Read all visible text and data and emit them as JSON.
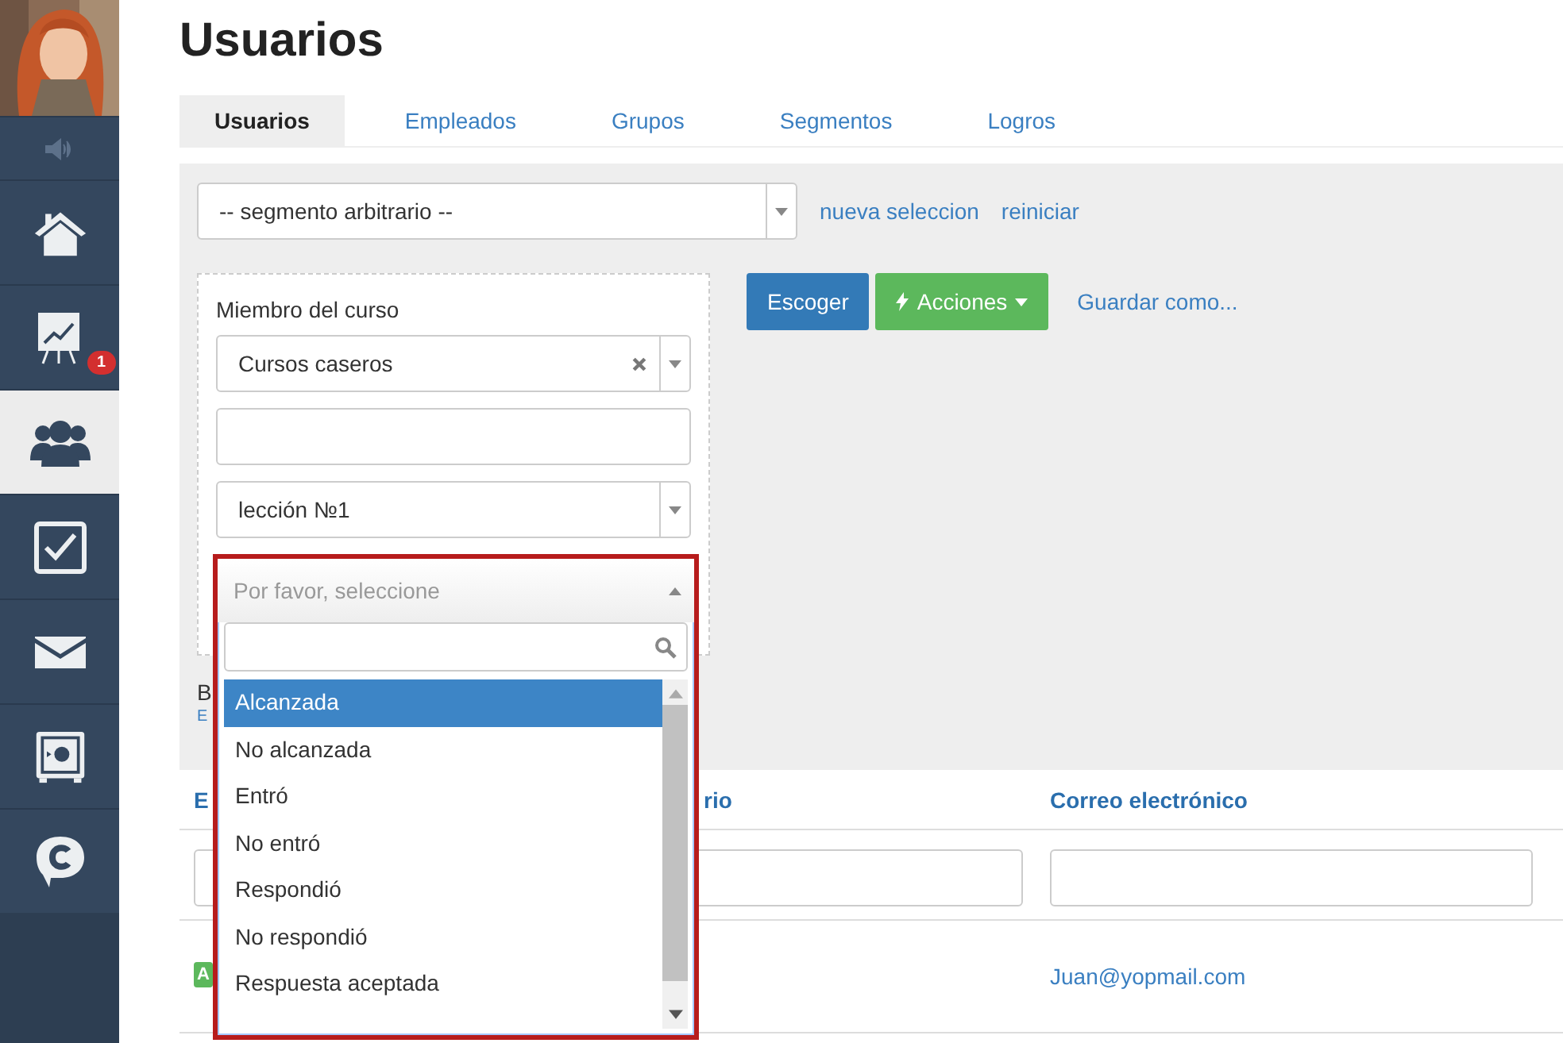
{
  "sidebar": {
    "items": [
      {
        "kind": "speaker",
        "selected": false
      },
      {
        "kind": "home",
        "selected": false
      },
      {
        "kind": "chart",
        "selected": false,
        "badge": "1"
      },
      {
        "kind": "users",
        "selected": true
      },
      {
        "kind": "check",
        "selected": false
      },
      {
        "kind": "mail",
        "selected": false
      },
      {
        "kind": "safe",
        "selected": false
      },
      {
        "kind": "chat",
        "selected": false
      }
    ]
  },
  "title": "Usuarios",
  "tabs": [
    {
      "label": "Usuarios",
      "selected": true
    },
    {
      "label": "Empleados",
      "selected": false
    },
    {
      "label": "Grupos",
      "selected": false
    },
    {
      "label": "Segmentos",
      "selected": false
    },
    {
      "label": "Logros",
      "selected": false
    }
  ],
  "segment_select": {
    "value": "-- segmento arbitrario --"
  },
  "links": [
    "nueva seleccion",
    "reiniciar"
  ],
  "filter": {
    "label": "Miembro del curso",
    "course_select": {
      "value": "Cursos caseros"
    },
    "lesson_select": {
      "value": "lección №1"
    }
  },
  "buttons": [
    {
      "label": "Escoger",
      "kind": "primary"
    },
    {
      "label": "Acciones",
      "kind": "actions"
    }
  ],
  "save_link": "Guardar como...",
  "panel_fragments": [
    "B",
    "E"
  ],
  "table": {
    "columns": [
      "E",
      "rio",
      "Correo electrónico"
    ],
    "rows": [
      {
        "badge": "A",
        "email": "Juan@yopmail.com"
      }
    ]
  },
  "dropdown": {
    "placeholder": "Por favor, seleccione",
    "options": [
      {
        "label": "Alcanzada",
        "selected": true
      },
      {
        "label": "No alcanzada",
        "selected": false
      },
      {
        "label": "Entró",
        "selected": false
      },
      {
        "label": "No entró",
        "selected": false
      },
      {
        "label": "Respondió",
        "selected": false
      },
      {
        "label": "No respondió",
        "selected": false
      },
      {
        "label": "Respuesta aceptada",
        "selected": false
      }
    ]
  }
}
